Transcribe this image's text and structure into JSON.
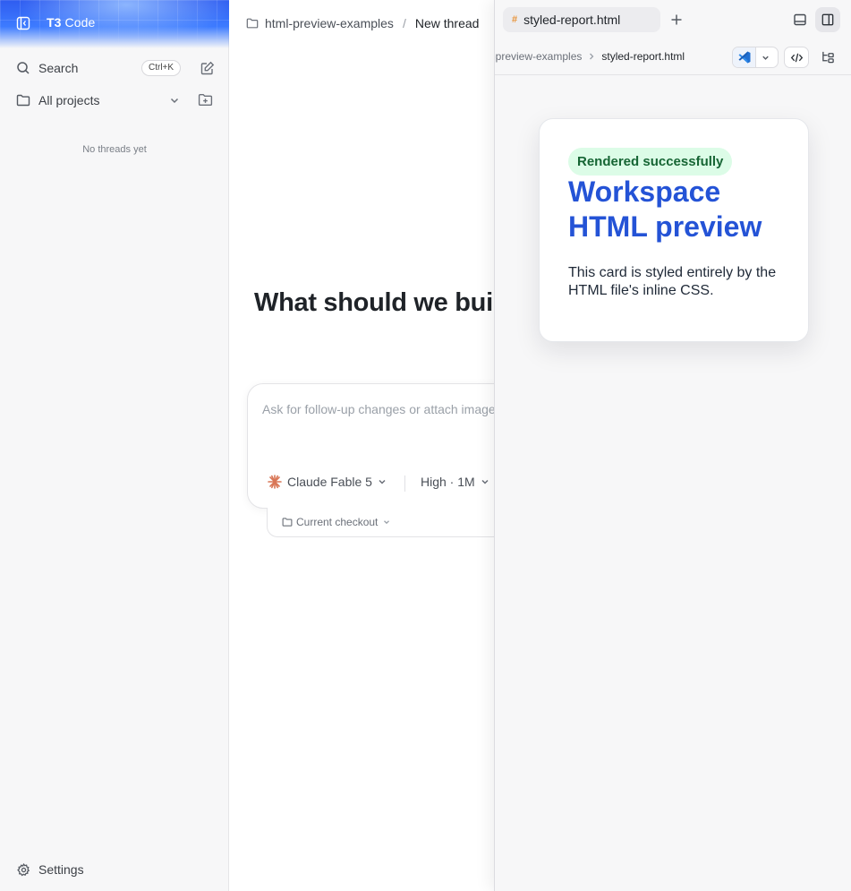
{
  "app": {
    "brand_short": "T3",
    "brand_rest": "Code"
  },
  "sidebar": {
    "search_label": "Search",
    "search_shortcut": "Ctrl+K",
    "projects_label": "All projects",
    "empty_text": "No threads yet",
    "settings_label": "Settings"
  },
  "main": {
    "breadcrumb_project": "html-preview-examples",
    "breadcrumb_separator": "/",
    "breadcrumb_thread": "New thread",
    "hero_text": "What should we build?",
    "composer_placeholder": "Ask for follow-up changes or attach images",
    "model_label": "Claude Fable 5",
    "effort_label": "High · 1M",
    "checkout_label": "Current checkout"
  },
  "preview": {
    "tab_label": "styled-report.html",
    "tab_icon": "#",
    "path_dir": "html-preview-examples",
    "path_file": "styled-report.html",
    "card": {
      "badge": "Rendered successfully",
      "title": "Workspace HTML preview",
      "body": "This card is styled entirely by the HTML file's inline CSS."
    }
  },
  "colors": {
    "brand_blue": "#3d7bff",
    "card_title": "#2453d6",
    "badge_bg": "#dcfce7",
    "badge_text": "#166534",
    "model_icon": "#d97757"
  }
}
